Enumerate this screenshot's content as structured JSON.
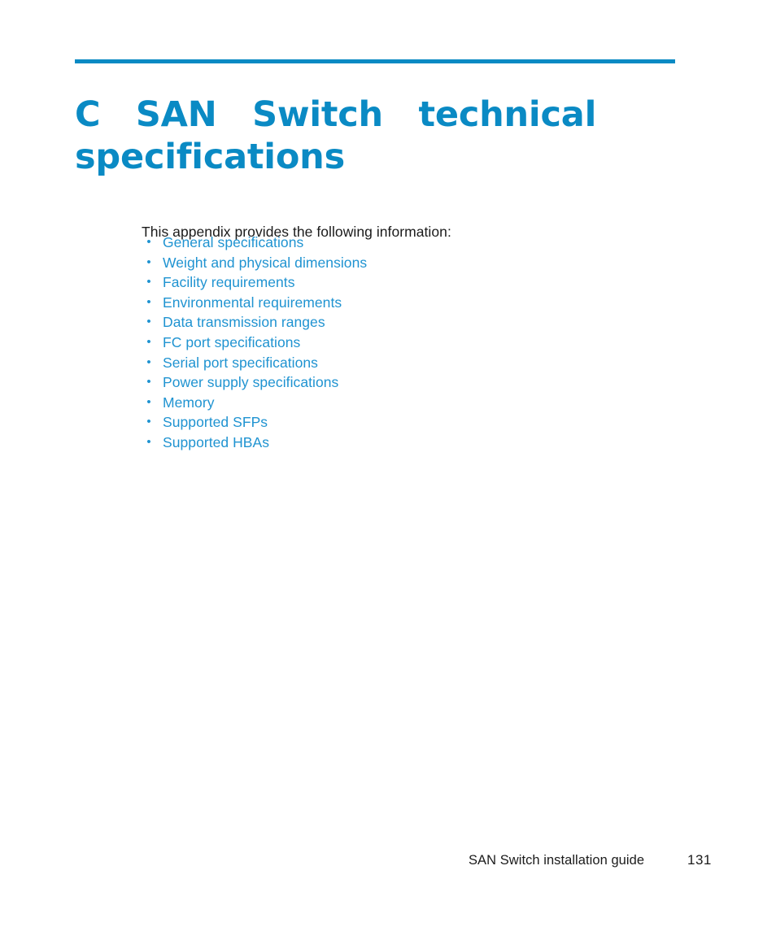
{
  "document": {
    "title_lines": [
      "C  SAN  Switch  technical",
      "specifications"
    ],
    "intro": "This appendix provides the following information:",
    "bullet_glyph": "•",
    "toc_items": [
      {
        "label": "General specifications"
      },
      {
        "label": "Weight and physical dimensions"
      },
      {
        "label": "Facility requirements"
      },
      {
        "label": "Environmental requirements"
      },
      {
        "label": "Data transmission ranges"
      },
      {
        "label": "FC port specifications"
      },
      {
        "label": "Serial port specifications"
      },
      {
        "label": "Power supply specifications"
      },
      {
        "label": "Memory"
      },
      {
        "label": "Supported SFPs"
      },
      {
        "label": "Supported HBAs"
      }
    ],
    "footer": {
      "guide_title": "SAN Switch installation guide",
      "page_number": "131"
    },
    "colors": {
      "heading_blue": "#0a8ac4",
      "link_blue": "#1f93d1",
      "body_text": "#1b1b1b",
      "page_background": "#ffffff"
    }
  }
}
